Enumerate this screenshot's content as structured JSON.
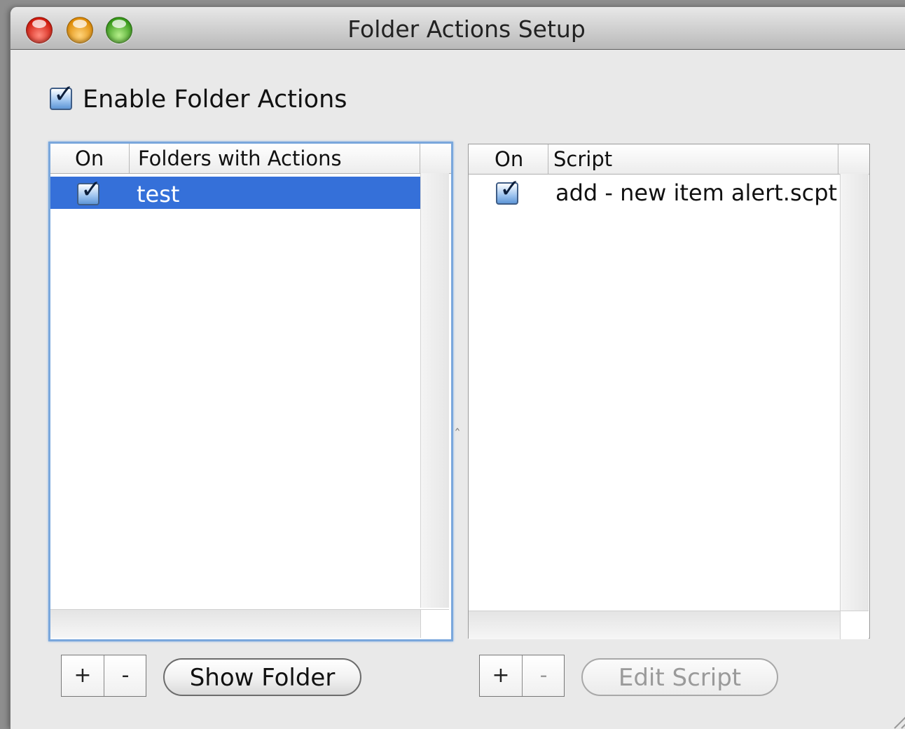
{
  "window": {
    "title": "Folder Actions Setup"
  },
  "enable": {
    "label": "Enable Folder Actions",
    "checked": true
  },
  "folders_table": {
    "columns": [
      "On",
      "Folders with Actions"
    ],
    "rows": [
      {
        "on": true,
        "name": "test",
        "selected": true
      }
    ],
    "add_label": "+",
    "remove_label": "-",
    "show_button": "Show Folder"
  },
  "scripts_table": {
    "columns": [
      "On",
      "Script"
    ],
    "rows": [
      {
        "on": true,
        "name": "add - new item alert.scpt",
        "selected": false
      }
    ],
    "add_label": "+",
    "remove_label": "-",
    "edit_button": "Edit Script"
  },
  "icons": {
    "close": "close-icon",
    "minimize": "minimize-icon",
    "zoom": "zoom-icon",
    "checkmark": "checkmark-icon",
    "resize": "resize-grip-icon"
  },
  "colors": {
    "selection": "#3570d9",
    "focus_ring": "#7aa7dc"
  }
}
